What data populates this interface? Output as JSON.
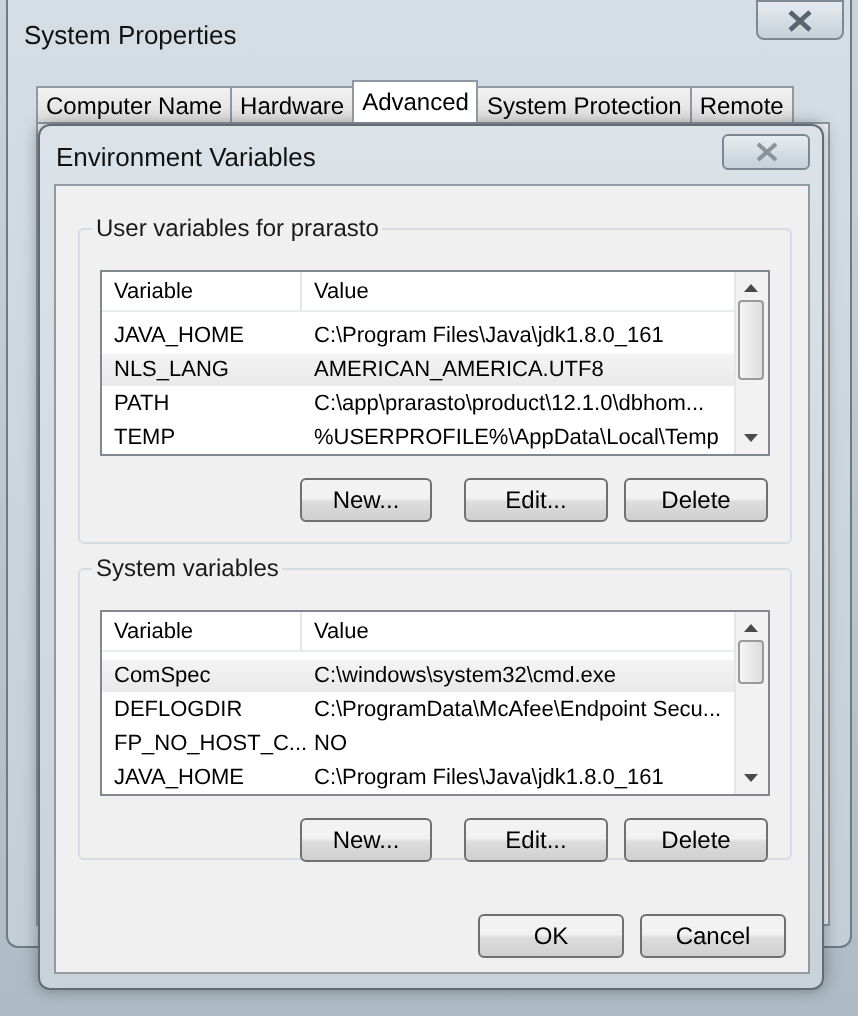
{
  "window": {
    "title": "System Properties"
  },
  "tabs": [
    {
      "label": "Computer Name",
      "selected": false
    },
    {
      "label": "Hardware",
      "selected": false
    },
    {
      "label": "Advanced",
      "selected": true
    },
    {
      "label": "System Protection",
      "selected": false
    },
    {
      "label": "Remote",
      "selected": false
    }
  ],
  "dialog": {
    "title": "Environment Variables",
    "groups": [
      {
        "title": "User variables for prarasto",
        "columns": [
          "Variable",
          "Value"
        ],
        "rows": [
          {
            "variable": "JAVA_HOME",
            "value": "C:\\Program Files\\Java\\jdk1.8.0_161",
            "highlighted": false
          },
          {
            "variable": "NLS_LANG",
            "value": "AMERICAN_AMERICA.UTF8",
            "highlighted": true
          },
          {
            "variable": "PATH",
            "value": "C:\\app\\prarasto\\product\\12.1.0\\dbhom...",
            "highlighted": false
          },
          {
            "variable": "TEMP",
            "value": "%USERPROFILE%\\AppData\\Local\\Temp",
            "highlighted": false
          }
        ],
        "buttons": [
          "New...",
          "Edit...",
          "Delete"
        ]
      },
      {
        "title": "System variables",
        "columns": [
          "Variable",
          "Value"
        ],
        "rows": [
          {
            "variable": "ComSpec",
            "value": "C:\\windows\\system32\\cmd.exe",
            "highlighted": true
          },
          {
            "variable": "DEFLOGDIR",
            "value": "C:\\ProgramData\\McAfee\\Endpoint Secu...",
            "highlighted": false
          },
          {
            "variable": "FP_NO_HOST_C...",
            "value": "NO",
            "highlighted": false
          },
          {
            "variable": "JAVA_HOME",
            "value": "C:\\Program Files\\Java\\jdk1.8.0_161",
            "highlighted": false
          }
        ],
        "buttons": [
          "New...",
          "Edit...",
          "Delete"
        ]
      }
    ],
    "buttons": [
      "OK",
      "Cancel"
    ]
  }
}
